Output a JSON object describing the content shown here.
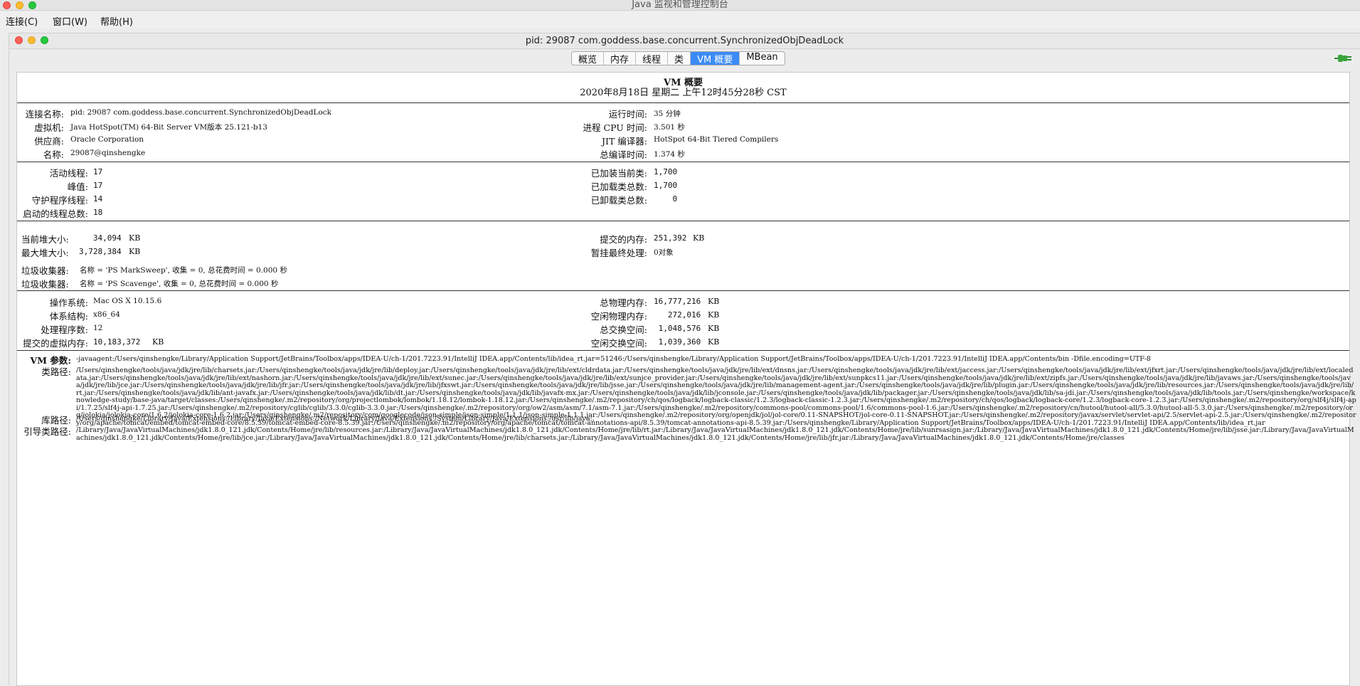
{
  "window": {
    "title": "Java 监视和管理控制台"
  },
  "menu": [
    "连接(C)",
    "窗口(W)",
    "帮助(H)"
  ],
  "frame": {
    "title": "pid: 29087 com.goddess.base.concurrent.SynchronizedObjDeadLock"
  },
  "tabs": [
    {
      "label": "概览",
      "active": false
    },
    {
      "label": "内存",
      "active": false
    },
    {
      "label": "线程",
      "active": false
    },
    {
      "label": "类",
      "active": false
    },
    {
      "label": "VM 概要",
      "active": true
    },
    {
      "label": "MBean",
      "active": false
    }
  ],
  "summary": {
    "heading": "VM 概要",
    "date": "2020年8月18日 星期二 上午12时45分28秒 CST"
  },
  "section1": {
    "left": [
      {
        "label": "连接名称:",
        "value": "pid: 29087 com.goddess.base.concurrent.SynchronizedObjDeadLock"
      },
      {
        "label": "虚拟机:",
        "value": "Java HotSpot(TM) 64-Bit Server VM版本 25.121-b13"
      },
      {
        "label": "供应商:",
        "value": "Oracle Corporation"
      },
      {
        "label": "名称:",
        "value": "29087@qinshengke"
      }
    ],
    "right": [
      {
        "label": "运行时间:",
        "value": "35 分钟"
      },
      {
        "label": "进程 CPU 时间:",
        "value": "3.501 秒"
      },
      {
        "label": "JIT 编译器:",
        "value": "HotSpot 64-Bit Tiered Compilers"
      },
      {
        "label": "总编译时间:",
        "value": "1.374 秒"
      }
    ]
  },
  "section2": {
    "left": [
      {
        "label": "活动线程:",
        "value": "17"
      },
      {
        "label": "峰值:",
        "value": "17"
      },
      {
        "label": "守护程序线程:",
        "value": "14"
      },
      {
        "label": "启动的线程总数:",
        "value": "18"
      }
    ],
    "right": [
      {
        "label": "已加装当前类:",
        "value": "1,700"
      },
      {
        "label": "已加载类总数:",
        "value": "1,700"
      },
      {
        "label": "已卸载类总数:",
        "value": "    0"
      }
    ]
  },
  "section3": {
    "left": [
      {
        "label": "当前堆大小:",
        "value": "   34,094",
        "unit": "KB"
      },
      {
        "label": "最大堆大小:",
        "value": "3,728,384",
        "unit": "KB"
      }
    ],
    "right": [
      {
        "label": "提交的内存:",
        "value": "251,392",
        "unit": "KB"
      },
      {
        "label": "暂挂最终处理:",
        "value": "0对象"
      }
    ],
    "gc": [
      {
        "label": "垃圾收集器:",
        "value": "名称 = 'PS MarkSweep', 收集 = 0, 总花费时间 = 0.000 秒"
      },
      {
        "label": "垃圾收集器:",
        "value": "名称 = 'PS Scavenge', 收集 = 0, 总花费时间 = 0.000 秒"
      }
    ]
  },
  "section4": {
    "left": [
      {
        "label": "操作系统:",
        "value": "Mac OS X 10.15.6"
      },
      {
        "label": "体系结构:",
        "value": "x86_64"
      },
      {
        "label": "处理程序数:",
        "value": "12"
      },
      {
        "label": "提交的虚拟内存:",
        "value": "10,183,372",
        "unit": "KB"
      }
    ],
    "right": [
      {
        "label": "总物理内存:",
        "value": "16,777,216",
        "unit": "KB"
      },
      {
        "label": "空闲物理内存:",
        "value": "   272,016",
        "unit": "KB"
      },
      {
        "label": "总交换空间:",
        "value": " 1,048,576",
        "unit": "KB"
      },
      {
        "label": "空闲交换空间:",
        "value": " 1,039,360",
        "unit": "KB"
      }
    ]
  },
  "section5": {
    "vm_args_label": "VM 参数:",
    "vm_args": "-javaagent:/Users/qinshengke/Library/Application Support/JetBrains/Toolbox/apps/IDEA-U/ch-1/201.7223.91/IntelliJ IDEA.app/Contents/lib/idea_rt.jar=51246:/Users/qinshengke/Library/Application Support/JetBrains/Toolbox/apps/IDEA-U/ch-1/201.7223.91/IntelliJ IDEA.app/Contents/bin -Dfile.encoding=UTF-8",
    "classpath_label": "类路径:",
    "classpath": "/Users/qinshengke/tools/java/jdk/jre/lib/charsets.jar:/Users/qinshengke/tools/java/jdk/jre/lib/deploy.jar:/Users/qinshengke/tools/java/jdk/jre/lib/ext/cldrdata.jar:/Users/qinshengke/tools/java/jdk/jre/lib/ext/dnsns.jar:/Users/qinshengke/tools/java/jdk/jre/lib/ext/jaccess.jar:/Users/qinshengke/tools/java/jdk/jre/lib/ext/jfxrt.jar:/Users/qinshengke/tools/java/jdk/jre/lib/ext/localedata.jar:/Users/qinshengke/tools/java/jdk/jre/lib/ext/nashorn.jar:/Users/qinshengke/tools/java/jdk/jre/lib/ext/sunec.jar:/Users/qinshengke/tools/java/jdk/jre/lib/ext/sunjce_provider.jar:/Users/qinshengke/tools/java/jdk/jre/lib/ext/sunpkcs11.jar:/Users/qinshengke/tools/java/jdk/jre/lib/ext/zipfs.jar:/Users/qinshengke/tools/java/jdk/jre/lib/javaws.jar:/Users/qinshengke/tools/java/jdk/jre/lib/jce.jar:/Users/qinshengke/tools/java/jdk/jre/lib/jfr.jar:/Users/qinshengke/tools/java/jdk/jre/lib/jfxswt.jar:/Users/qinshengke/tools/java/jdk/jre/lib/jsse.jar:/Users/qinshengke/tools/java/jdk/jre/lib/management-agent.jar:/Users/qinshengke/tools/java/jdk/jre/lib/plugin.jar:/Users/qinshengke/tools/java/jdk/jre/lib/resources.jar:/Users/qinshengke/tools/java/jdk/jre/lib/rt.jar:/Users/qinshengke/tools/java/jdk/lib/ant-javafx.jar:/Users/qinshengke/tools/java/jdk/lib/dt.jar:/Users/qinshengke/tools/java/jdk/lib/javafx-mx.jar:/Users/qinshengke/tools/java/jdk/lib/jconsole.jar:/Users/qinshengke/tools/java/jdk/lib/packager.jar:/Users/qinshengke/tools/java/jdk/lib/sa-jdi.jar:/Users/qinshengke/tools/java/jdk/lib/tools.jar:/Users/qinshengke/workspace/knowledge-study/base-java/target/classes:/Users/qinshengke/.m2/repository/org/projectlombok/lombok/1.18.12/lombok-1.18.12.jar:/Users/qinshengke/.m2/repository/ch/qos/logback/logback-classic/1.2.3/logback-classic-1.2.3.jar:/Users/qinshengke/.m2/repository/ch/qos/logback/logback-core/1.2.3/logback-core-1.2.3.jar:/Users/qinshengke/.m2/repository/org/slf4j/slf4j-api/1.7.25/slf4j-api-1.7.25.jar:/Users/qinshengke/.m2/repository/cglib/cglib/3.3.0/cglib-3.3.0.jar:/Users/qinshengke/.m2/repository/org/ow2/asm/asm/7.1/asm-7.1.jar:/Users/qinshengke/.m2/repository/commons-pool/commons-pool/1.6/commons-pool-1.6.jar:/Users/qinshengke/.m2/repository/cn/hutool/hutool-all/5.3.0/hutool-all-5.3.0.jar:/Users/qinshengke/.m2/repository/org/jolokia/jolokia-core/1.6.2/jolokia-core-1.6.2.jar:/Users/qinshengke/.m2/repository/com/googlecode/json-simple/json-simple/1.1.1/json-simple-1.1.1.jar:/Users/qinshengke/.m2/repository/org/openjdk/jol/jol-core/0.11-SNAPSHOT/jol-core-0.11-SNAPSHOT.jar:/Users/qinshengke/.m2/repository/javax/servlet/servlet-api/2.5/servlet-api-2.5.jar:/Users/qinshengke/.m2/repository/org/apache/tomcat/embed/tomcat-embed-core/8.5.39/tomcat-embed-core-8.5.39.jar:/Users/qinshengke/.m2/repository/org/apache/tomcat/tomcat-annotations-api/8.5.39/tomcat-annotations-api-8.5.39.jar:/Users/qinshengke/Library/Application Support/JetBrains/Toolbox/apps/IDEA-U/ch-1/201.7223.91/IntelliJ IDEA.app/Contents/lib/idea_rt.jar",
    "libpath_label": "库路径:",
    "libpath": "/Users/qinshengke/Library/Java/Extensions:/Library/Java/Extensions:/Network/Library/Java/Extensions:/System/Library/Java/Extensions:/usr/lib/java:.",
    "bootpath_label": "引导类路径:",
    "bootpath": "/Library/Java/JavaVirtualMachines/jdk1.8.0_121.jdk/Contents/Home/jre/lib/resources.jar:/Library/Java/JavaVirtualMachines/jdk1.8.0_121.jdk/Contents/Home/jre/lib/rt.jar:/Library/Java/JavaVirtualMachines/jdk1.8.0_121.jdk/Contents/Home/jre/lib/sunrsasign.jar:/Library/Java/JavaVirtualMachines/jdk1.8.0_121.jdk/Contents/Home/jre/lib/jsse.jar:/Library/Java/JavaVirtualMachines/jdk1.8.0_121.jdk/Contents/Home/jre/lib/jce.jar:/Library/Java/JavaVirtualMachines/jdk1.8.0_121.jdk/Contents/Home/jre/lib/charsets.jar:/Library/Java/JavaVirtualMachines/jdk1.8.0_121.jdk/Contents/Home/jre/lib/jfr.jar:/Library/Java/JavaVirtualMachines/jdk1.8.0_121.jdk/Contents/Home/jre/classes"
  },
  "icons": {
    "connection": "plug-connected-icon"
  },
  "colors": {
    "tab_active": "#3c8bf5",
    "connection_icon": "#3aa43a"
  }
}
